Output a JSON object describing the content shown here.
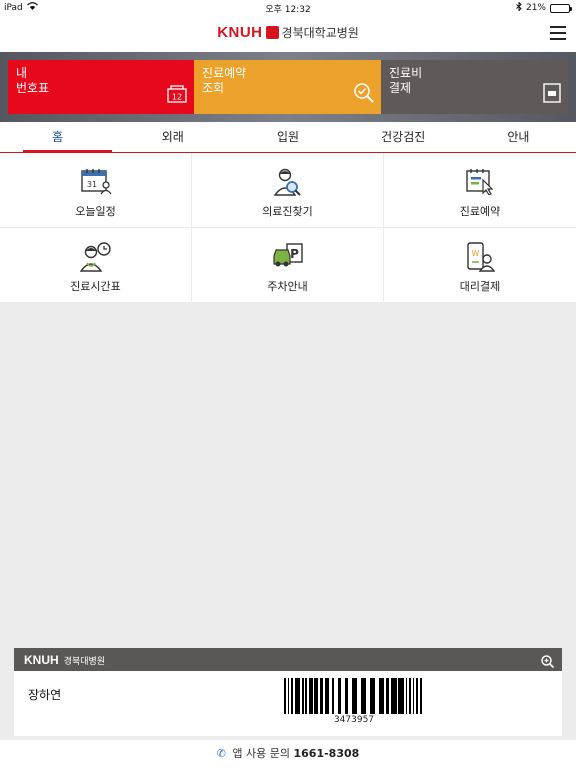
{
  "status_bar": {
    "device": "iPad",
    "time": "오후 12:32",
    "battery": "21%",
    "battery_level": 0.21
  },
  "header": {
    "logo_en": "KNUH",
    "logo_ko": "경북대학교병원",
    "menu_icon": "hamburger-menu-icon"
  },
  "quick_tiles": [
    {
      "line1": "내",
      "line2": "번호표",
      "icon": "ticket-number-icon",
      "icon_text": "12",
      "color": "#e8081c"
    },
    {
      "line1": "진료예약",
      "line2": "조회",
      "icon": "search-check-icon",
      "color": "#eba12a"
    },
    {
      "line1": "진료비",
      "line2": "결제",
      "icon": "payment-card-icon",
      "color": "#5f5a58"
    }
  ],
  "tabs": [
    {
      "label": "홈",
      "active": true
    },
    {
      "label": "외래",
      "active": false
    },
    {
      "label": "입원",
      "active": false
    },
    {
      "label": "건강검진",
      "active": false
    },
    {
      "label": "안내",
      "active": false
    }
  ],
  "grid": [
    {
      "label": "오늘일정",
      "icon": "calendar-icon"
    },
    {
      "label": "의료진찾기",
      "icon": "doctor-search-icon"
    },
    {
      "label": "진료예약",
      "icon": "reservation-icon"
    },
    {
      "label": "진료시간표",
      "icon": "doctor-clock-icon"
    },
    {
      "label": "주차안내",
      "icon": "parking-car-icon"
    },
    {
      "label": "대리결제",
      "icon": "mobile-pay-icon"
    }
  ],
  "card": {
    "brand_en": "KNUH",
    "brand_ko": "경북대병원",
    "patient_name": "장하연",
    "barcode_number": "3473957",
    "zoom_icon": "zoom-in-icon"
  },
  "footer": {
    "label": "앱 사용 문의",
    "phone": "1661-8308",
    "icon": "phone-icon"
  },
  "colors": {
    "accent_red": "#d7141e",
    "tab_active": "#1e4f9a",
    "icon_blue": "#3a6fb0",
    "icon_green": "#7cb342"
  }
}
